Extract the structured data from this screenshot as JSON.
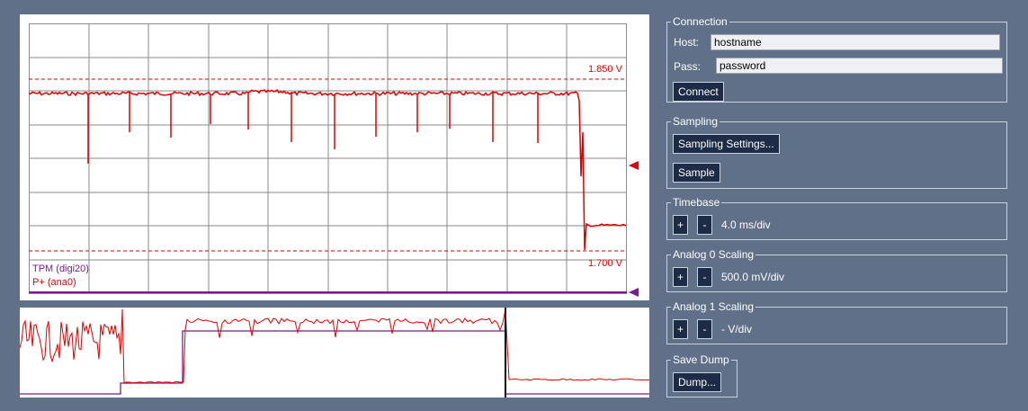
{
  "scope": {
    "marker_upper": "1.850 V",
    "marker_lower": "1.700 V",
    "legend": [
      "TPM (digi20)",
      "P+ (ana0)"
    ],
    "colors": {
      "analog": "#e00000",
      "digital": "#7a1b8c",
      "grid": "#8a8a8a"
    }
  },
  "connection": {
    "title": "Connection",
    "host_label": "Host:",
    "host_value": "hostname",
    "pass_label": "Pass:",
    "pass_value": "password",
    "connect_label": "Connect"
  },
  "sampling": {
    "title": "Sampling",
    "settings_label": "Sampling Settings...",
    "sample_label": "Sample"
  },
  "timebase": {
    "title": "Timebase",
    "plus": "+",
    "minus": "-",
    "value": "4.0 ms/div"
  },
  "analog0": {
    "title": "Analog 0 Scaling",
    "plus": "+",
    "minus": "-",
    "value": "500.0 mV/div"
  },
  "analog1": {
    "title": "Analog 1 Scaling",
    "plus": "+",
    "minus": "-",
    "value": "- V/div"
  },
  "dump": {
    "title": "Save Dump",
    "dump_label": "Dump..."
  }
}
